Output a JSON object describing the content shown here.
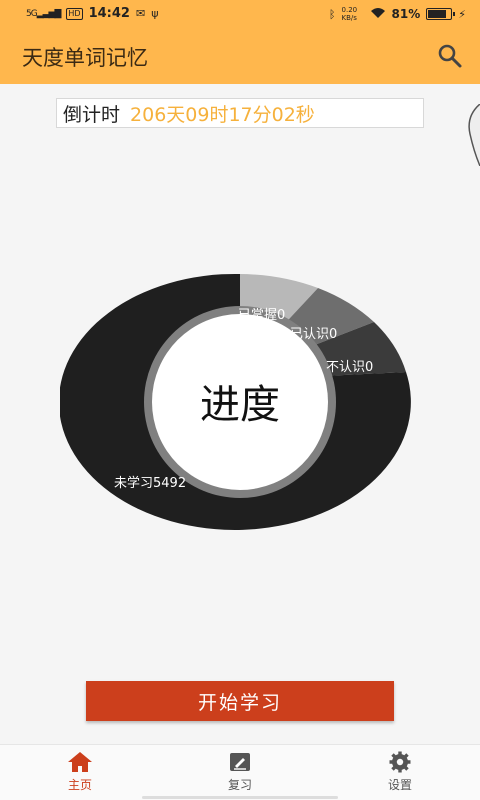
{
  "status_bar": {
    "network": "5G",
    "hd": "HD",
    "time": "14:42",
    "speed": "0.20 KB/s",
    "battery_text": "81%",
    "battery_level": 0.81,
    "icons": [
      "signal-icon",
      "wechat-icon",
      "usb-icon",
      "bluetooth-icon",
      "wifi-icon",
      "battery-icon",
      "charging-icon"
    ]
  },
  "app_bar": {
    "title": "天度单词记忆",
    "search_icon": "search-icon"
  },
  "countdown": {
    "label": "倒计时",
    "value": "206天09时17分02秒"
  },
  "progress": {
    "center_label": "进度",
    "segments": [
      {
        "label": "已掌握0",
        "color": "#b8b8b8"
      },
      {
        "label": "已认识0",
        "color": "#6e6e6e"
      },
      {
        "label": "不认识0",
        "color": "#3b3b3b"
      },
      {
        "label": "未学习5492",
        "color": "#1f1f1f"
      }
    ]
  },
  "start_button": {
    "label": "开始学习",
    "color": "#cc3f1c"
  },
  "bottom_nav": {
    "items": [
      {
        "label": "主页",
        "icon": "home-icon",
        "active": true
      },
      {
        "label": "复习",
        "icon": "review-icon",
        "active": false
      },
      {
        "label": "设置",
        "icon": "gear-icon",
        "active": false
      }
    ]
  }
}
